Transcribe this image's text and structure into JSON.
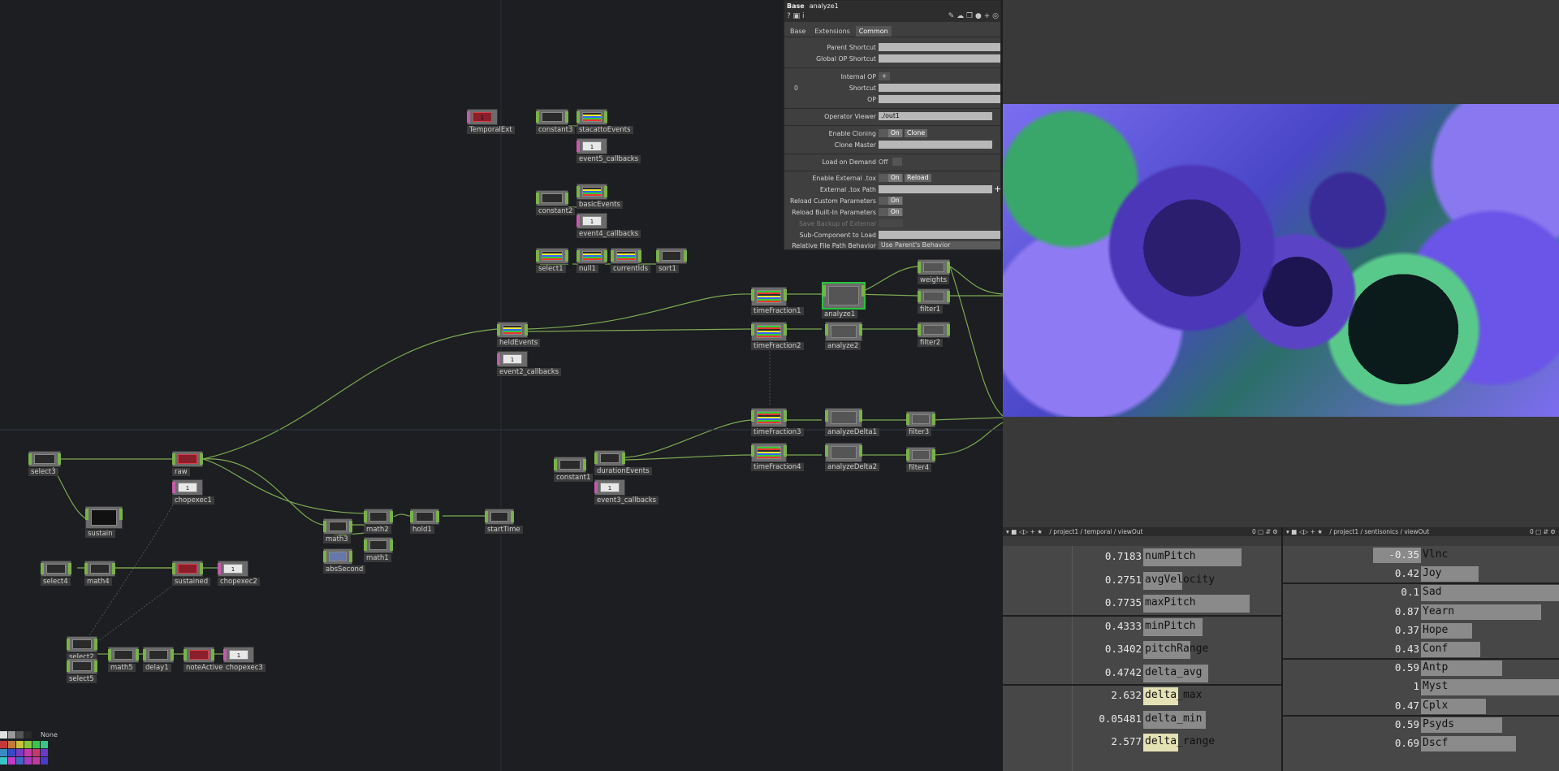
{
  "network": {
    "nodes": [
      {
        "id": "TemporalExt",
        "label": "TemporalExt",
        "kind": "dat red"
      },
      {
        "id": "constant3",
        "label": "constant3",
        "kind": "chop"
      },
      {
        "id": "stacattoEvents",
        "label": "stacattoEvents",
        "kind": "chop rainbow"
      },
      {
        "id": "event5_callbacks",
        "label": "event5_callbacks",
        "kind": "dat"
      },
      {
        "id": "constant2",
        "label": "constant2",
        "kind": "chop"
      },
      {
        "id": "basicEvents",
        "label": "basicEvents",
        "kind": "chop rainbow"
      },
      {
        "id": "event4_callbacks",
        "label": "event4_callbacks",
        "kind": "dat"
      },
      {
        "id": "select1",
        "label": "select1",
        "kind": "chop rainbow"
      },
      {
        "id": "null1",
        "label": "null1",
        "kind": "chop rainbow"
      },
      {
        "id": "currentIds",
        "label": "currentIds",
        "kind": "chop rainbow"
      },
      {
        "id": "sort1",
        "label": "sort1",
        "kind": "chop"
      },
      {
        "id": "heldEvents",
        "label": "heldEvents",
        "kind": "chop rainbow"
      },
      {
        "id": "event2_callbacks",
        "label": "event2_callbacks",
        "kind": "dat"
      },
      {
        "id": "timeFraction1",
        "label": "timeFraction1",
        "kind": "chop rainbow"
      },
      {
        "id": "analyze1",
        "label": "analyze1",
        "kind": "chop sel"
      },
      {
        "id": "weights",
        "label": "weights",
        "kind": "chop"
      },
      {
        "id": "filter1",
        "label": "filter1",
        "kind": "chop"
      },
      {
        "id": "timeFraction2",
        "label": "timeFraction2",
        "kind": "chop rainbow"
      },
      {
        "id": "analyze2",
        "label": "analyze2",
        "kind": "chop"
      },
      {
        "id": "filter2",
        "label": "filter2",
        "kind": "chop"
      },
      {
        "id": "timeFraction3",
        "label": "timeFraction3",
        "kind": "chop rainbow"
      },
      {
        "id": "analyzeDelta1",
        "label": "analyzeDelta1",
        "kind": "chop"
      },
      {
        "id": "filter3",
        "label": "filter3",
        "kind": "chop"
      },
      {
        "id": "timeFraction4",
        "label": "timeFraction4",
        "kind": "chop rainbow"
      },
      {
        "id": "analyzeDelta2",
        "label": "analyzeDelta2",
        "kind": "chop"
      },
      {
        "id": "filter4",
        "label": "filter4",
        "kind": "chop"
      },
      {
        "id": "constant1",
        "label": "constant1",
        "kind": "chop"
      },
      {
        "id": "durationEvents",
        "label": "durationEvents",
        "kind": "chop"
      },
      {
        "id": "event3_callbacks",
        "label": "event3_callbacks",
        "kind": "dat"
      },
      {
        "id": "select3",
        "label": "select3",
        "kind": "chop"
      },
      {
        "id": "raw",
        "label": "raw",
        "kind": "chop red"
      },
      {
        "id": "chopexec1",
        "label": "chopexec1",
        "kind": "dat"
      },
      {
        "id": "sustain",
        "label": "sustain",
        "kind": "top"
      },
      {
        "id": "math3",
        "label": "math3",
        "kind": "chop"
      },
      {
        "id": "math2",
        "label": "math2",
        "kind": "chop"
      },
      {
        "id": "hold1",
        "label": "hold1",
        "kind": "chop"
      },
      {
        "id": "startTime",
        "label": "startTime",
        "kind": "chop"
      },
      {
        "id": "absSecond",
        "label": "absSecond",
        "kind": "chop"
      },
      {
        "id": "math1",
        "label": "math1",
        "kind": "chop"
      },
      {
        "id": "select4",
        "label": "select4",
        "kind": "chop"
      },
      {
        "id": "math4",
        "label": "math4",
        "kind": "chop"
      },
      {
        "id": "sustained",
        "label": "sustained",
        "kind": "chop red"
      },
      {
        "id": "chopexec2",
        "label": "chopexec2",
        "kind": "dat"
      },
      {
        "id": "select2",
        "label": "select2",
        "kind": "chop"
      },
      {
        "id": "select5",
        "label": "select5",
        "kind": "chop"
      },
      {
        "id": "math5",
        "label": "math5",
        "kind": "chop"
      },
      {
        "id": "delay1",
        "label": "delay1",
        "kind": "chop"
      },
      {
        "id": "noteActive",
        "label": "noteActive",
        "kind": "chop red"
      },
      {
        "id": "chopexec3",
        "label": "chopexec3",
        "kind": "dat"
      }
    ],
    "palette_label": "None"
  },
  "params": {
    "type": "Base",
    "name": "analyze1",
    "tabs": [
      "Base",
      "Extensions",
      "Common"
    ],
    "active_tab": "Common",
    "rows": {
      "parent_shortcut": "Parent Shortcut",
      "global_op_shortcut": "Global OP Shortcut",
      "internal_op": "Internal OP",
      "index0": "0",
      "shortcut": "Shortcut",
      "op": "OP",
      "operator_viewer": "Operator Viewer",
      "operator_viewer_value": "./out1",
      "enable_cloning": "Enable Cloning",
      "on": "On",
      "clone": "Clone",
      "clone_master": "Clone Master",
      "load_on_demand": "Load on Demand",
      "off": "Off",
      "enable_external_tox": "Enable External .tox",
      "reload": "Reload",
      "external_tox_path": "External .tox Path",
      "reload_custom": "Reload Custom Parameters",
      "reload_builtin": "Reload Built-In Parameters",
      "save_backup": "Save Backup of External",
      "sub_component": "Sub-Component to Load",
      "relative_file_path": "Relative File Path Behavior",
      "relative_file_path_value": "Use Parent's Behavior"
    }
  },
  "paneA": {
    "path": "/ project1 / temporal / viewOut",
    "page": "0",
    "rows": [
      {
        "value": "0.7183",
        "name": "numPitch",
        "fill": 0.71,
        "hi": false
      },
      {
        "value": "0.2751",
        "name": "avgVelocity",
        "fill": 0.28,
        "hi": false
      },
      {
        "value": "0.7735",
        "name": "maxPitch",
        "fill": 0.77,
        "hi": false
      },
      {
        "value": "0.4333",
        "name": "minPitch",
        "fill": 0.43,
        "hi": false
      },
      {
        "value": "0.3402",
        "name": "pitchRange",
        "fill": 0.34,
        "hi": false
      },
      {
        "value": "0.4742",
        "name": "delta_avg",
        "fill": 0.47,
        "hi": false
      },
      {
        "value": "2.632",
        "name": "delta_max",
        "fill": 0.25,
        "hi": true
      },
      {
        "value": "0.05481",
        "name": "delta_min",
        "fill": 0.45,
        "hi": false
      },
      {
        "value": "2.577",
        "name": "delta_range",
        "fill": 0.25,
        "hi": true
      }
    ]
  },
  "paneB": {
    "path": "/ project1 / sentisonics / viewOut",
    "page": "0",
    "rows": [
      {
        "value": "-0.35",
        "name": "Vlnc",
        "fill": -0.35
      },
      {
        "value": "0.42",
        "name": "Joy",
        "fill": 0.42
      },
      {
        "value": "0.1",
        "name": "Sad",
        "fill": 1.0
      },
      {
        "value": "0.87",
        "name": "Yearn",
        "fill": 0.87
      },
      {
        "value": "0.37",
        "name": "Hope",
        "fill": 0.37
      },
      {
        "value": "0.43",
        "name": "Conf",
        "fill": 0.43
      },
      {
        "value": "0.59",
        "name": "Antp",
        "fill": 0.59
      },
      {
        "value": "1",
        "name": "Myst",
        "fill": 1.0
      },
      {
        "value": "0.47",
        "name": "Cplx",
        "fill": 0.47
      },
      {
        "value": "0.59",
        "name": "Psyds",
        "fill": 0.59
      },
      {
        "value": "0.69",
        "name": "Dscf",
        "fill": 0.69
      }
    ]
  },
  "colors": {
    "wire": "#8fc25a",
    "selected": "#27c43a",
    "dat": "#c25ca8",
    "chop": "#7ab24a"
  }
}
